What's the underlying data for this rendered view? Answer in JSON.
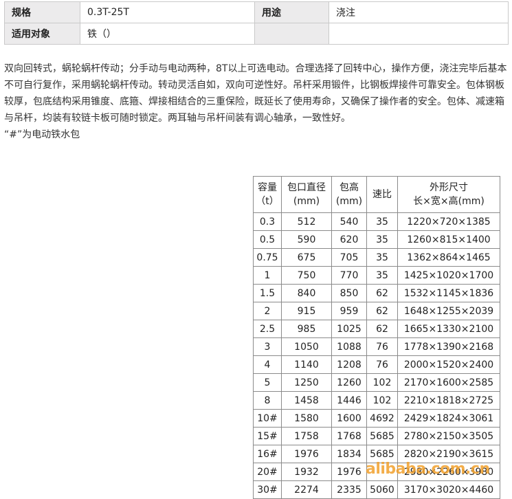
{
  "spec": {
    "row1": {
      "k1": "规格",
      "v1": "0.3T-25T",
      "k2": "用途",
      "v2": "浇注"
    },
    "row2": {
      "k1": "适用对象",
      "v1": "铁（）",
      "k2": "",
      "v2": ""
    }
  },
  "description": {
    "p1": "双向回转式，蜗轮蜗杆传动；分手动与电动两种，8T以上可选电动。合理选择了回转中心，操作方便，浇注完毕后基本不可自行复作，采用蜗轮蜗杆传动。转动灵活自如，双向可逆性好。吊杆采用锻件，比钢板焊接件可靠安全。包体钢板较厚，包底结构采用锥度、底箍、焊接相结合的三重保险，既延长了使用寿命，又确保了操作者的安全。包体、减速箱与吊杆，均装有较链卡板可随时锁定。两耳轴与吊杆间装有调心轴承，一致性好。",
    "p2": "“#”为电动铁水包"
  },
  "table": {
    "headers": [
      {
        "l1": "容量",
        "l2": "（t）"
      },
      {
        "l1": "包口直径",
        "l2": "(mm)"
      },
      {
        "l1": "包高",
        "l2": "(mm)"
      },
      {
        "l1": "速比",
        "l2": ""
      },
      {
        "l1": "外形尺寸",
        "l2": "长×宽×高(mm)"
      }
    ],
    "rows": [
      [
        "0.3",
        "512",
        "540",
        "35",
        "1220×720×1385"
      ],
      [
        "0.5",
        "590",
        "620",
        "35",
        "1260×815×1400"
      ],
      [
        "0.75",
        "675",
        "705",
        "35",
        "1362×864×1465"
      ],
      [
        "1",
        "750",
        "770",
        "35",
        "1425×1020×1700"
      ],
      [
        "1.5",
        "840",
        "850",
        "62",
        "1532×1145×1836"
      ],
      [
        "2",
        "915",
        "959",
        "62",
        "1648×1255×2039"
      ],
      [
        "2.5",
        "985",
        "1025",
        "62",
        "1665×1330×2100"
      ],
      [
        "3",
        "1050",
        "1088",
        "76",
        "1778×1390×2168"
      ],
      [
        "4",
        "1140",
        "1208",
        "76",
        "2000×1520×2400"
      ],
      [
        "5",
        "1250",
        "1260",
        "102",
        "2170×1600×2585"
      ],
      [
        "8",
        "1458",
        "1446",
        "102",
        "2210×1818×2725"
      ],
      [
        "10#",
        "1580",
        "1600",
        "4692",
        "2429×1824×3061"
      ],
      [
        "15#",
        "1758",
        "1768",
        "5685",
        "2780×2150×3505"
      ],
      [
        "16#",
        "1976",
        "1834",
        "5685",
        "2820×2190×3615"
      ],
      [
        "20#",
        "1932",
        "1976",
        "",
        "2980×2260×3980"
      ],
      [
        "30#",
        "2274",
        "2335",
        "5060",
        "3170×3020×4460"
      ]
    ]
  },
  "watermark": "alibaba.com.cn"
}
